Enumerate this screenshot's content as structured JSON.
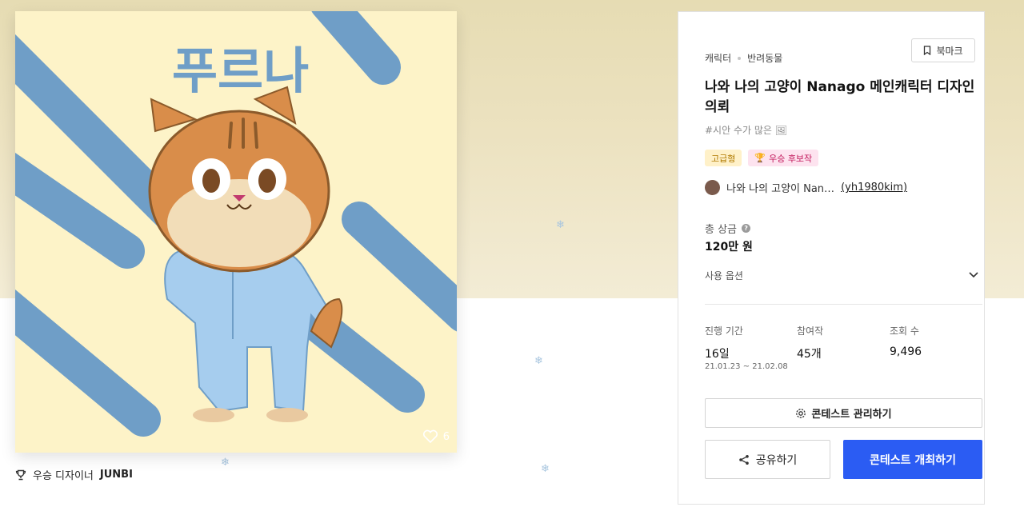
{
  "artwork": {
    "lettering": "푸르나",
    "likes": "6"
  },
  "winner": {
    "label": "우승 디자이너",
    "name": "JUNBI"
  },
  "panel": {
    "category_main": "캐릭터",
    "category_sub": "반려동물",
    "bookmark_label": "북마크",
    "title": "나와 나의 고양이 Nanago 메인캐릭터 디자인 의뢰",
    "hashtag": "#시안 수가 많은 🖼",
    "badges": {
      "premium": "고급형",
      "candidate": "우승 후보작"
    },
    "host_name": "나와 나의 고양이 Nan…",
    "host_id": "(yh1980kim)",
    "prize_label": "총 상금",
    "prize_value": "120만 원",
    "usage_label": "사용 옵션",
    "stats": {
      "duration_label": "진행 기간",
      "duration_value": "16일",
      "duration_dates": "21.01.23 ~ 21.02.08",
      "entries_label": "참여작",
      "entries_value": "45개",
      "views_label": "조회 수",
      "views_value": "9,496"
    },
    "manage_button": "콘테스트 관리하기",
    "share_button": "공유하기",
    "host_button": "콘테스트 개최하기"
  },
  "colors": {
    "primary": "#2b5cf3",
    "hero_bg": "#e6dcb3",
    "art_bg": "#fdf3c8",
    "art_stripe": "#6f9ec7"
  },
  "icons": {
    "bookmark": "bookmark-icon",
    "trophy": "trophy-icon",
    "heart": "heart-icon",
    "help": "help-icon",
    "chevron": "chevron-down-icon",
    "gear": "gear-icon",
    "share": "share-icon"
  }
}
